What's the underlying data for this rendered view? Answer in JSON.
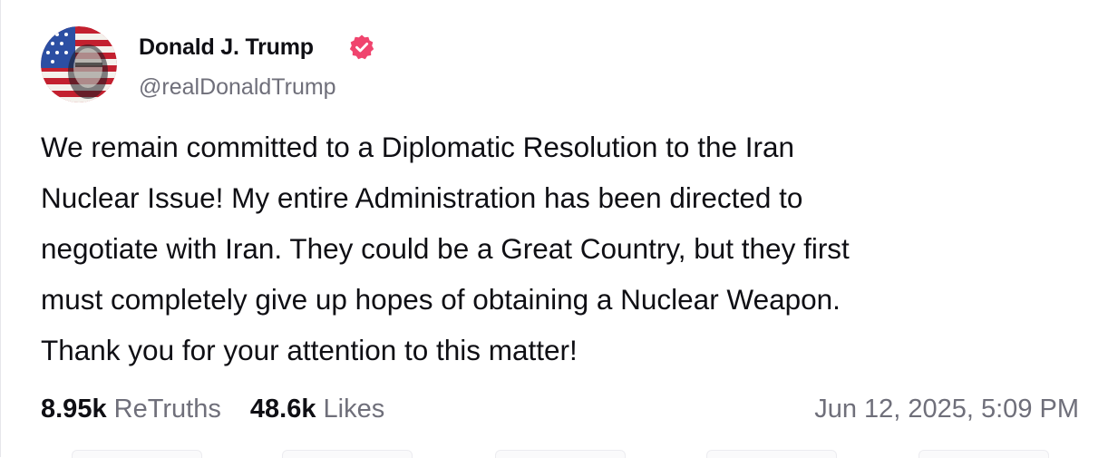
{
  "author": {
    "display_name": "Donald J. Trump",
    "handle": "@realDonaldTrump",
    "verified": true,
    "verified_color": "#f0446e",
    "avatar_icon": "avatar-flag-portrait"
  },
  "post": {
    "lines": [
      "We remain committed to a Diplomatic Resolution to the Iran",
      "Nuclear Issue! My entire Administration has been directed to",
      "negotiate with Iran. They could be a Great Country, but they first",
      "must completely give up hopes of obtaining a Nuclear Weapon.",
      "Thank you for your attention to this matter!"
    ]
  },
  "stats": {
    "retruths_count": "8.95k",
    "retruths_label": "ReTruths",
    "likes_count": "48.6k",
    "likes_label": "Likes"
  },
  "timestamp": "Jun 12, 2025, 5:09 PM",
  "colors": {
    "text": "#0f0f14",
    "muted": "#6f6f7a"
  }
}
